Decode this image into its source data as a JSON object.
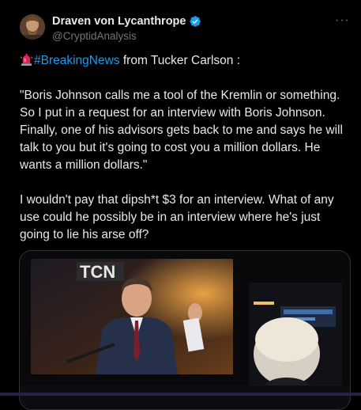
{
  "author": {
    "display_name": "Draven von Lycanthrope",
    "handle": "@CryptidAnalysis",
    "verified": true
  },
  "more_menu_label": "···",
  "post": {
    "hashtag": "#BreakingNews",
    "lead_rest": " from Tucker Carlson :",
    "quote": "\"Boris Johnson calls me a tool of the Kremlin or something. So I put in a request for an interview with Boris Johnson. Finally, one of his advisors gets back to me and says he will talk to you but it's going to cost you a million dollars. He wants a million dollars.\"",
    "comment": "I wouldn't pay that dipsh*t $3 for an interview. What of any use could he possibly be in an interview where he's just going to lie his arse off?"
  },
  "media": {
    "screen_logo_text": "TCN",
    "icon": "video-thumbnail"
  },
  "colors": {
    "background": "#000000",
    "text": "#e7e9ea",
    "secondary": "#71767b",
    "link": "#1d9bf0",
    "verified": "#1d9bf0"
  }
}
